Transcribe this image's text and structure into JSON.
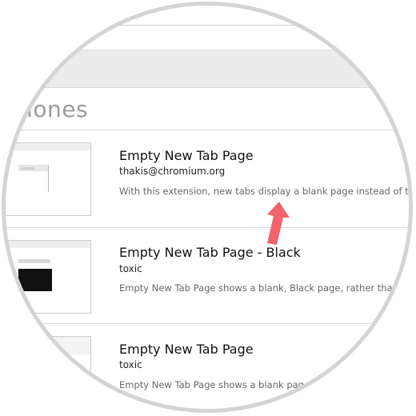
{
  "section": {
    "title": "siones"
  },
  "extensions": [
    {
      "title": "Empty New Tab Page",
      "author": "thakis@chromium.org",
      "description": "With this extension, new tabs display a blank page instead of the c"
    },
    {
      "title": "Empty New Tab Page - Black",
      "author": "toxic",
      "description": "Empty New Tab Page shows a blank, Black page, rather than th"
    },
    {
      "title": "Empty New Tab Page",
      "author": "toxic",
      "description": "Empty New Tab Page shows a blank page"
    }
  ],
  "colors": {
    "arrow": "#f26469",
    "ring": "#d4d4d4",
    "band": "#ececec"
  },
  "icons": {
    "pointer": "arrow-up-right-icon"
  }
}
